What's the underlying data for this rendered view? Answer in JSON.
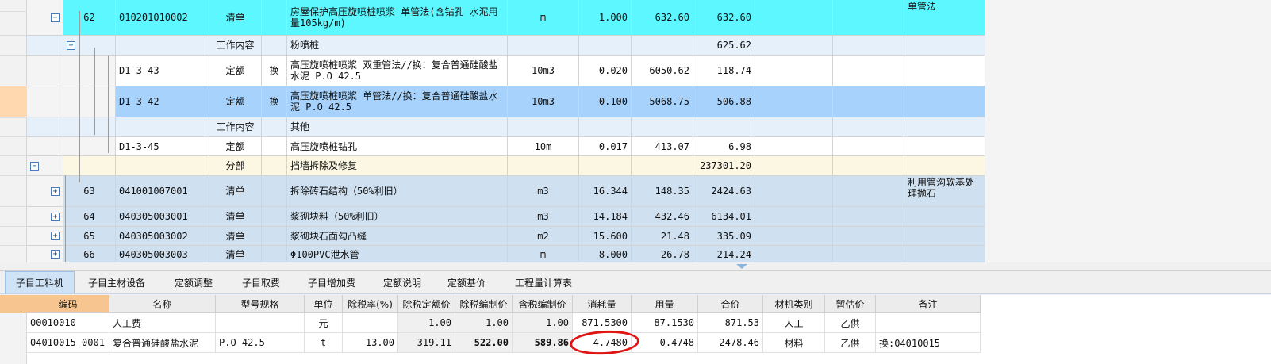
{
  "top_rows": [
    {
      "kind": "qingdan",
      "toggle": "−",
      "seq": "62",
      "code": "010201010002",
      "category": "清单",
      "mark": "",
      "name": "房屋保护高压旋喷桩喷浆 单管法(含钻孔 水泥用量105kg/m)",
      "unit": "m",
      "qty": "1.000",
      "price": "632.60",
      "total": "632.60",
      "note": "单管法"
    },
    {
      "kind": "work",
      "toggle": "−",
      "seq": "",
      "code": "",
      "category": "工作内容",
      "mark": "",
      "name": "粉喷桩",
      "unit": "",
      "qty": "",
      "price": "",
      "total": "625.62",
      "note": ""
    },
    {
      "kind": "dinge",
      "toggle": "",
      "seq": "",
      "code": "D1-3-43",
      "category": "定额",
      "mark": "换",
      "name": "高压旋喷桩喷浆 双重管法//换：复合普通硅酸盐水泥 P.O 42.5",
      "unit": "10m3",
      "qty": "0.020",
      "price": "6050.62",
      "total": "118.74",
      "note": ""
    },
    {
      "kind": "dinge-sel",
      "toggle": "",
      "seq": "",
      "code": "D1-3-42",
      "category": "定额",
      "mark": "换",
      "name": "高压旋喷桩喷浆 单管法//换：复合普通硅酸盐水泥 P.O 42.5",
      "unit": "10m3",
      "qty": "0.100",
      "price": "5068.75",
      "total": "506.88",
      "note": ""
    },
    {
      "kind": "work",
      "toggle": "",
      "seq": "",
      "code": "",
      "category": "工作内容",
      "mark": "",
      "name": "其他",
      "unit": "",
      "qty": "",
      "price": "",
      "total": "",
      "note": ""
    },
    {
      "kind": "dinge",
      "toggle": "",
      "seq": "",
      "code": "D1-3-45",
      "category": "定额",
      "mark": "",
      "name": "高压旋喷桩钻孔",
      "unit": "10m",
      "qty": "0.017",
      "price": "413.07",
      "total": "6.98",
      "note": ""
    },
    {
      "kind": "fenbu",
      "toggle": "−",
      "seq": "",
      "code": "",
      "category": "分部",
      "mark": "",
      "name": "挡墙拆除及修复",
      "unit": "",
      "qty": "",
      "price": "",
      "total": "237301.20",
      "note": ""
    },
    {
      "kind": "qd2",
      "toggle": "+",
      "seq": "63",
      "code": "041001007001",
      "category": "清单",
      "mark": "",
      "name": "拆除砖石结构（50%利旧）",
      "unit": "m3",
      "qty": "16.344",
      "price": "148.35",
      "total": "2424.63",
      "note": "利用管沟软基处理抛石"
    },
    {
      "kind": "qd2",
      "toggle": "+",
      "seq": "64",
      "code": "040305003001",
      "category": "清单",
      "mark": "",
      "name": "浆砌块料（50%利旧）",
      "unit": "m3",
      "qty": "14.184",
      "price": "432.46",
      "total": "6134.01",
      "note": ""
    },
    {
      "kind": "qd2",
      "toggle": "+",
      "seq": "65",
      "code": "040305003002",
      "category": "清单",
      "mark": "",
      "name": "浆砌块石面勾凸缝",
      "unit": "m2",
      "qty": "15.600",
      "price": "21.48",
      "total": "335.09",
      "note": ""
    },
    {
      "kind": "qd2",
      "toggle": "+",
      "seq": "66",
      "code": "040305003003",
      "category": "清单",
      "mark": "",
      "name": "Φ100PVC泄水管",
      "unit": "m",
      "qty": "8.000",
      "price": "26.78",
      "total": "214.24",
      "note": ""
    }
  ],
  "tabs": [
    "子目工料机",
    "子目主材设备",
    "定额调整",
    "子目取费",
    "子目增加费",
    "定额说明",
    "定额基价",
    "工程量计算表"
  ],
  "active_tab": 0,
  "bottom_headers": [
    "编码",
    "名称",
    "型号规格",
    "单位",
    "除税率(%)",
    "除税定额价",
    "除税编制价",
    "含税编制价",
    "消耗量",
    "用量",
    "合价",
    "材机类别",
    "暂估价",
    "备注"
  ],
  "bottom_rows": [
    [
      "00010010",
      "人工费",
      "",
      "元",
      "",
      "1.00",
      "1.00",
      "1.00",
      "871.5300",
      "87.1530",
      "871.53",
      "人工",
      "乙供",
      ""
    ],
    [
      "04010015-0001",
      "复合普通硅酸盐水泥",
      "P.O 42.5",
      "t",
      "13.00",
      "319.11",
      "522.00",
      "589.86",
      "4.7480",
      "0.4748",
      "2478.46",
      "材料",
      "乙供",
      "换:04010015"
    ]
  ],
  "colors": {
    "qingdan": "#5cf7ff",
    "work": "#e5f0fa",
    "dinge": "#ffffff",
    "dinge_sel": "#a6d2fb",
    "fenbu": "#fbf7e2",
    "qd2": "#cfe0f0",
    "highlight": "#e11414"
  }
}
